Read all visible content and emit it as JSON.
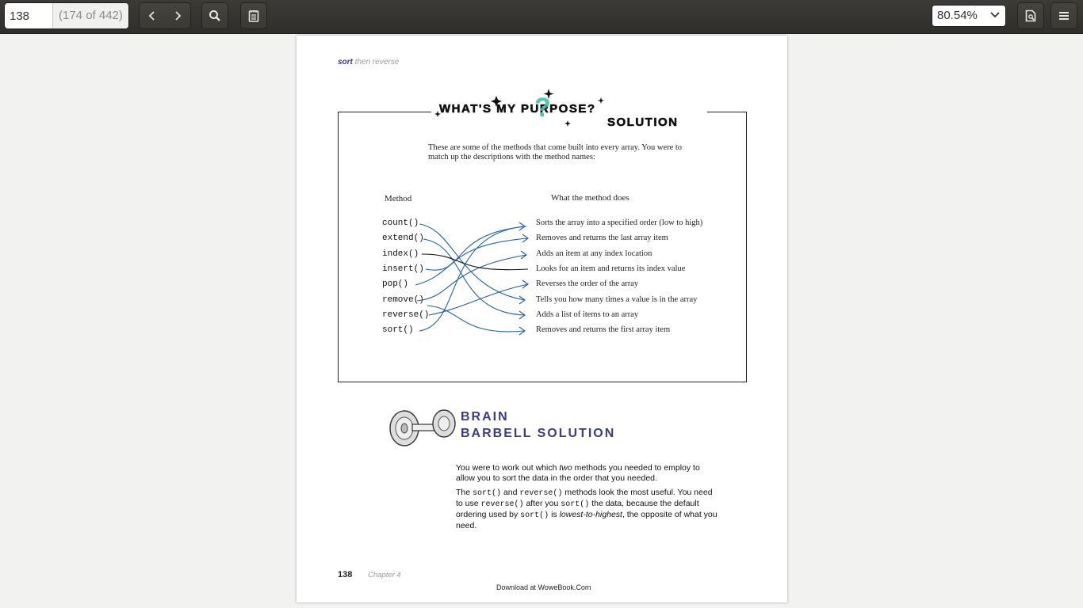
{
  "toolbar": {
    "page_value": "138",
    "page_count": "(174 of 442)",
    "zoom": "80.54%",
    "icons": [
      "chevron-left-icon",
      "chevron-right-icon",
      "search-icon",
      "annotations-icon",
      "document-properties-icon",
      "menu-icon"
    ]
  },
  "page": {
    "running_head_bold": "sort",
    "running_head_rest": " then reverse",
    "title_line1": "WHAT'S MY PURPOSE?",
    "title_line2": "SOLUTION",
    "intro": "These are some of the methods that come built into every array. You were to match up the descriptions with the method names:",
    "col_method": "Method",
    "col_desc": "What the method does",
    "methods": [
      "count()",
      "extend()",
      "index()",
      "insert()",
      "pop()",
      "remove()",
      "reverse()",
      "sort()"
    ],
    "descriptions": [
      "Sorts the array into a specified order (low to high)",
      "Removes and returns the last array item",
      "Adds an item at any index location",
      "Looks for an item and returns its index value",
      "Reverses the order of the array",
      "Tells you how many times a value is in the array",
      "Adds a list of items to an array",
      "Removes and returns the first array item"
    ],
    "barbell_line1": "BRAIN",
    "barbell_line2": "BARBELL SOLUTION",
    "sol_p1_a": "You were to work out which ",
    "sol_p1_em": "two",
    "sol_p1_b": " methods you needed to employ to allow you to sort the data in the order that you needed.",
    "sol_p2_a": "The ",
    "sol_p2_code1": "sort()",
    "sol_p2_b": " and ",
    "sol_p2_code2": "reverse()",
    "sol_p2_c": " methods look the most useful. You need to use ",
    "sol_p2_code3": "reverse()",
    "sol_p2_d": " after you ",
    "sol_p2_code4": "sort()",
    "sol_p2_e": " the data, because the default ordering used by ",
    "sol_p2_code5": "sort()",
    "sol_p2_f": " is ",
    "sol_p2_em": "lowest-to-highest",
    "sol_p2_g": ", the opposite of what you need.",
    "page_number": "138",
    "chapter": "Chapter 4",
    "download": "Download at WoweBook.Com"
  },
  "colors": {
    "accent": "#3b3c86",
    "link_lines": "#1f5fa8",
    "teal": "#3fbfa6"
  }
}
